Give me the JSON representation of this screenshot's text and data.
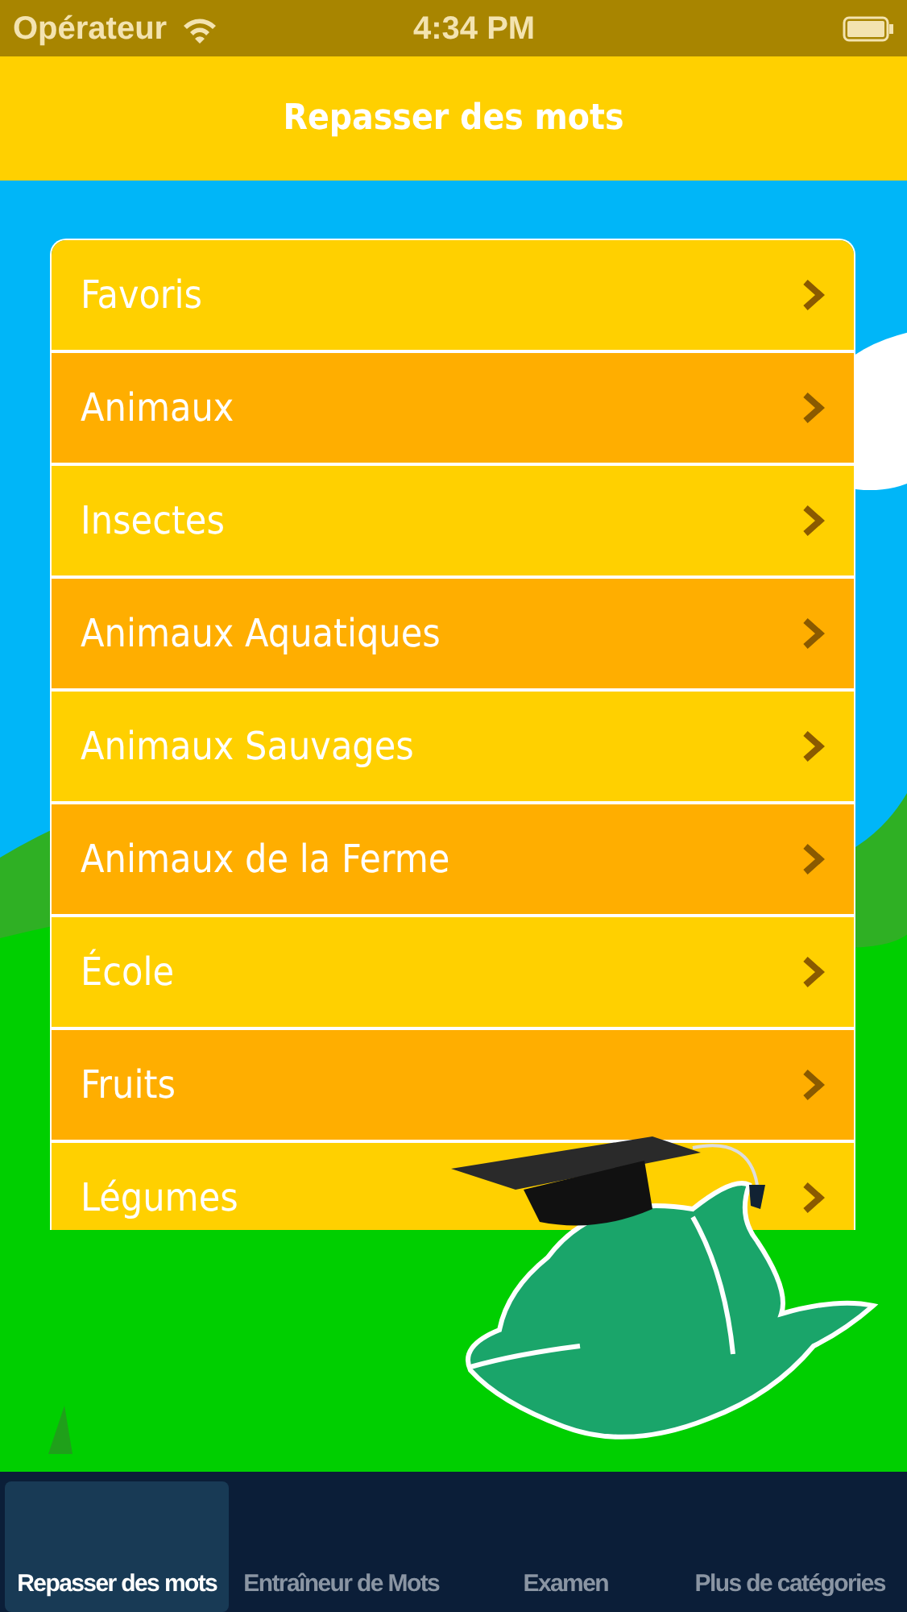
{
  "status_bar": {
    "carrier": "Opérateur",
    "time": "4:34 PM"
  },
  "nav_bar": {
    "title": "Repasser des mots"
  },
  "categories": [
    {
      "label": "Favoris"
    },
    {
      "label": "Animaux"
    },
    {
      "label": "Insectes"
    },
    {
      "label": "Animaux Aquatiques"
    },
    {
      "label": "Animaux Sauvages"
    },
    {
      "label": "Animaux de la Ferme"
    },
    {
      "label": "École"
    },
    {
      "label": "Fruits"
    },
    {
      "label": "Légumes"
    }
  ],
  "tabs": [
    {
      "label": "Repasser des mots",
      "selected": true
    },
    {
      "label": "Entraîneur de Mots",
      "selected": false
    },
    {
      "label": "Examen",
      "selected": false
    },
    {
      "label": "Plus de catégories",
      "selected": false
    }
  ]
}
